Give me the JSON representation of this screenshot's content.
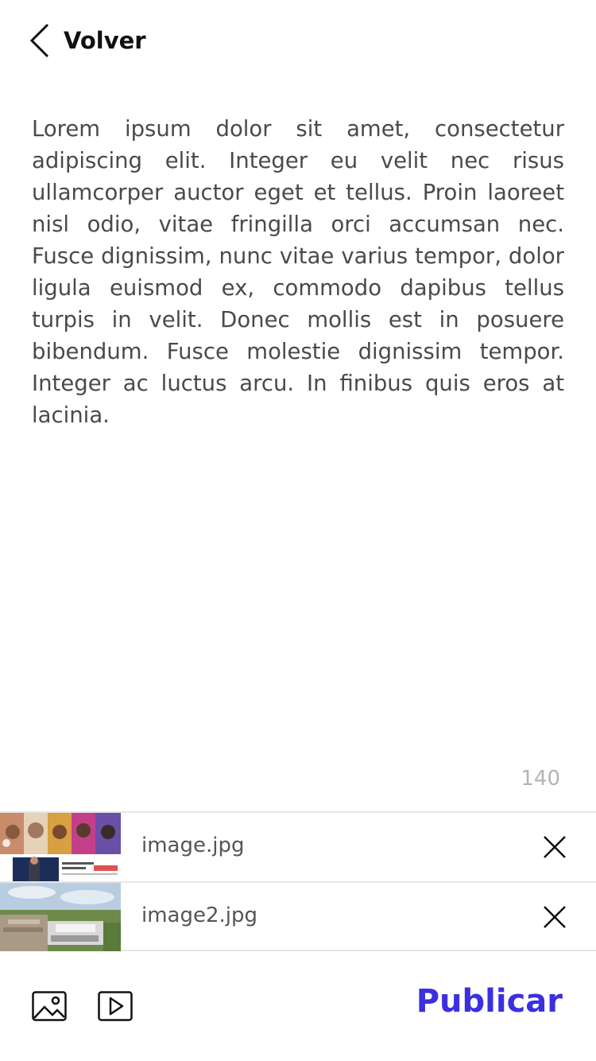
{
  "header": {
    "back_label": "Volver",
    "back_icon": "chevron-left-icon"
  },
  "post": {
    "body": "Lorem ipsum dolor sit amet, consectetur adipiscing elit. Integer eu velit nec risus ullamcorper auctor eget et tellus. Proin laoreet nisl odio, vitae fringilla orci accumsan nec. Fusce dignissim, nunc vitae varius tempor, dolor ligula euismod ex, commodo dapibus tellus turpis in velit. Donec mollis est in posuere bibendum. Fusce molestie dignissim tempor. Integer ac luctus arcu. In finibus quis eros at lacinia.",
    "char_count": "140"
  },
  "attachments": [
    {
      "filename": "image.jpg",
      "remove_icon": "close-icon"
    },
    {
      "filename": "image2.jpg",
      "remove_icon": "close-icon"
    }
  ],
  "toolbar": {
    "image_icon": "image-icon",
    "video_icon": "video-play-icon",
    "publish_label": "Publicar"
  },
  "colors": {
    "accent": "#3b2fe0",
    "text": "#4a4a4a",
    "muted": "#b4b4b4",
    "divider": "#e6e6e6"
  }
}
